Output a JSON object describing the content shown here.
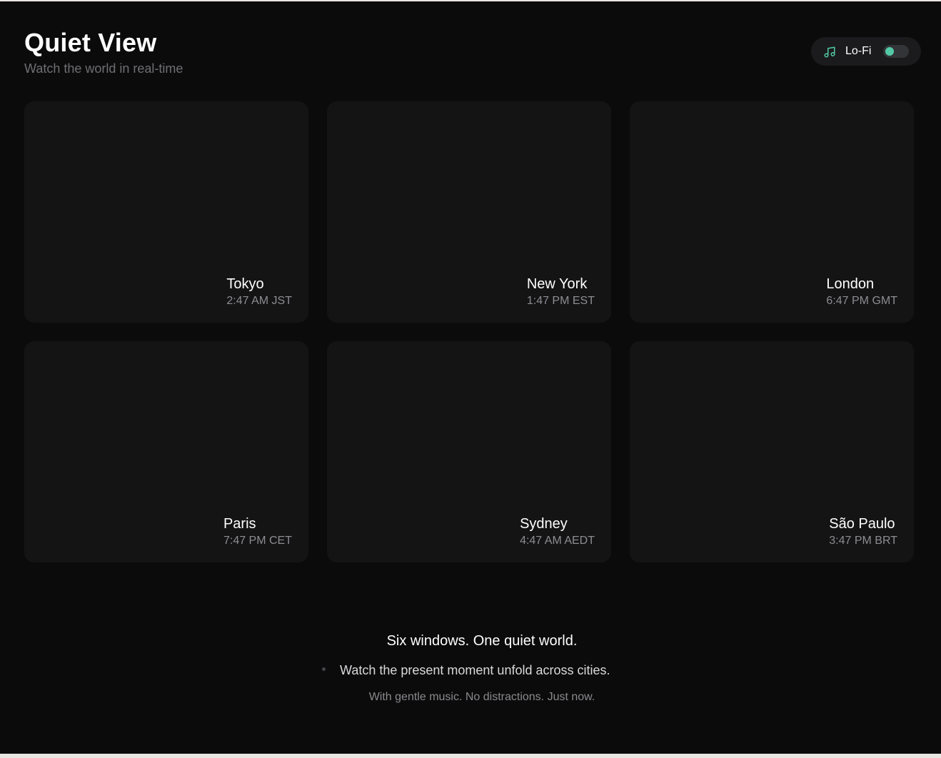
{
  "app": {
    "title": "Quiet View",
    "subtitle": "Watch the world in real-time"
  },
  "lofi": {
    "label": "Lo-Fi",
    "icon": "music-note-icon",
    "enabled": false,
    "accent_color": "#53c9a6"
  },
  "cities": [
    {
      "name": "Tokyo",
      "time": "2:47 AM JST"
    },
    {
      "name": "New York",
      "time": "1:47 PM EST"
    },
    {
      "name": "London",
      "time": "6:47 PM GMT"
    },
    {
      "name": "Paris",
      "time": "7:47 PM CET"
    },
    {
      "name": "Sydney",
      "time": "4:47 AM AEDT"
    },
    {
      "name": "São Paulo",
      "time": "3:47 PM BRT"
    }
  ],
  "footer": {
    "headline": "Six windows. One quiet world.",
    "line2": "Watch the present moment unfold across cities.",
    "line3": "With gentle music. No distractions. Just now."
  }
}
